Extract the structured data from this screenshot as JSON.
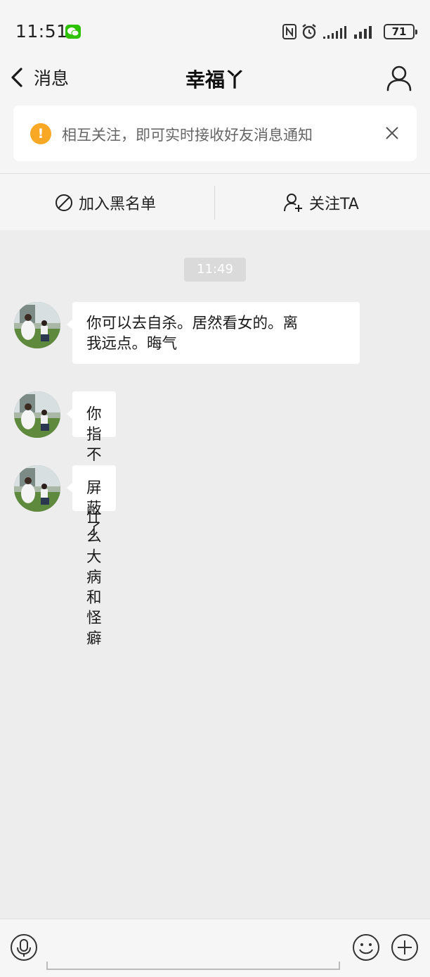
{
  "status_bar": {
    "time": "11:51",
    "battery": "71",
    "icons": [
      "wechat-icon",
      "nfc-icon",
      "alarm-icon",
      "signal-icon",
      "signal-icon",
      "battery-icon"
    ]
  },
  "nav": {
    "back_label": "消息",
    "title": "幸福丫"
  },
  "notice": {
    "text": "相互关注，即可实时接收好友消息通知",
    "icon_char": "!",
    "icon_color": "#f9a825"
  },
  "actions": {
    "blacklist_label": "加入黑名单",
    "follow_label": "关注TA"
  },
  "chat": {
    "timestamp": "11:49",
    "messages": [
      {
        "line1": "你可以去自杀。居然看女的。离",
        "line2": "我远点。晦气"
      },
      {
        "text": "你指不定有什么大病和怪癖"
      },
      {
        "text": "屏蔽了"
      }
    ]
  },
  "colors": {
    "background": "#ededed",
    "bubble": "#ffffff",
    "accent_warning": "#f9a825",
    "wechat_green": "#2dc100"
  }
}
